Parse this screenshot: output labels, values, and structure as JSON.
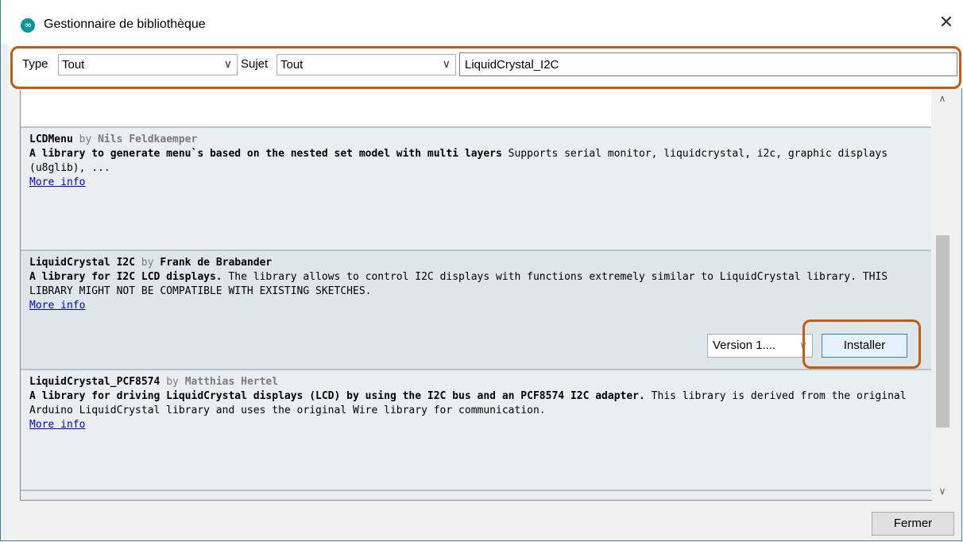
{
  "window": {
    "title": "Gestionnaire de bibliothèque",
    "app_icon_glyph": "∞",
    "close_glyph": "✕"
  },
  "filters": {
    "type_label": "Type",
    "type_value": "Tout",
    "topic_label": "Sujet",
    "topic_value": "Tout",
    "search_value": "LiquidCrystal_I2C",
    "dropdown_glyph": "∨"
  },
  "libraries": [
    {
      "name": "LCDMenu",
      "by": "by",
      "author": "Nils Feldkaemper",
      "sentence": "A library to generate menu`s based on the nested set model with multi layers",
      "paragraph": "Supports serial monitor, liquidcrystal, i2c, graphic displays (u8glib), ...",
      "more_info": "More info"
    },
    {
      "name": "LiquidCrystal I2C",
      "by": "by",
      "author": "Frank de Brabander",
      "sentence": "A library for I2C LCD displays.",
      "paragraph": "The library allows to control I2C displays with functions extremely similar to LiquidCrystal library. THIS LIBRARY MIGHT NOT BE COMPATIBLE WITH EXISTING SKETCHES.",
      "more_info": "More info",
      "version_label": "Version 1....",
      "install_label": "Installer"
    },
    {
      "name": "LiquidCrystal_PCF8574",
      "by": "by",
      "author": "Matthias Hertel",
      "sentence": "A library for driving LiquidCrystal displays (LCD) by using the I2C bus and an PCF8574 I2C adapter.",
      "paragraph": "This library is derived from the original Arduino LiquidCrystal library and uses the original Wire library for communication.",
      "more_info": "More info"
    }
  ],
  "scrollbar": {
    "up_glyph": "∧",
    "down_glyph": "∨"
  },
  "footer": {
    "close_label": "Fermer"
  },
  "colors": {
    "highlight": "#c55a11",
    "link": "#0000ee",
    "entry_bg": "#e9eff0"
  }
}
